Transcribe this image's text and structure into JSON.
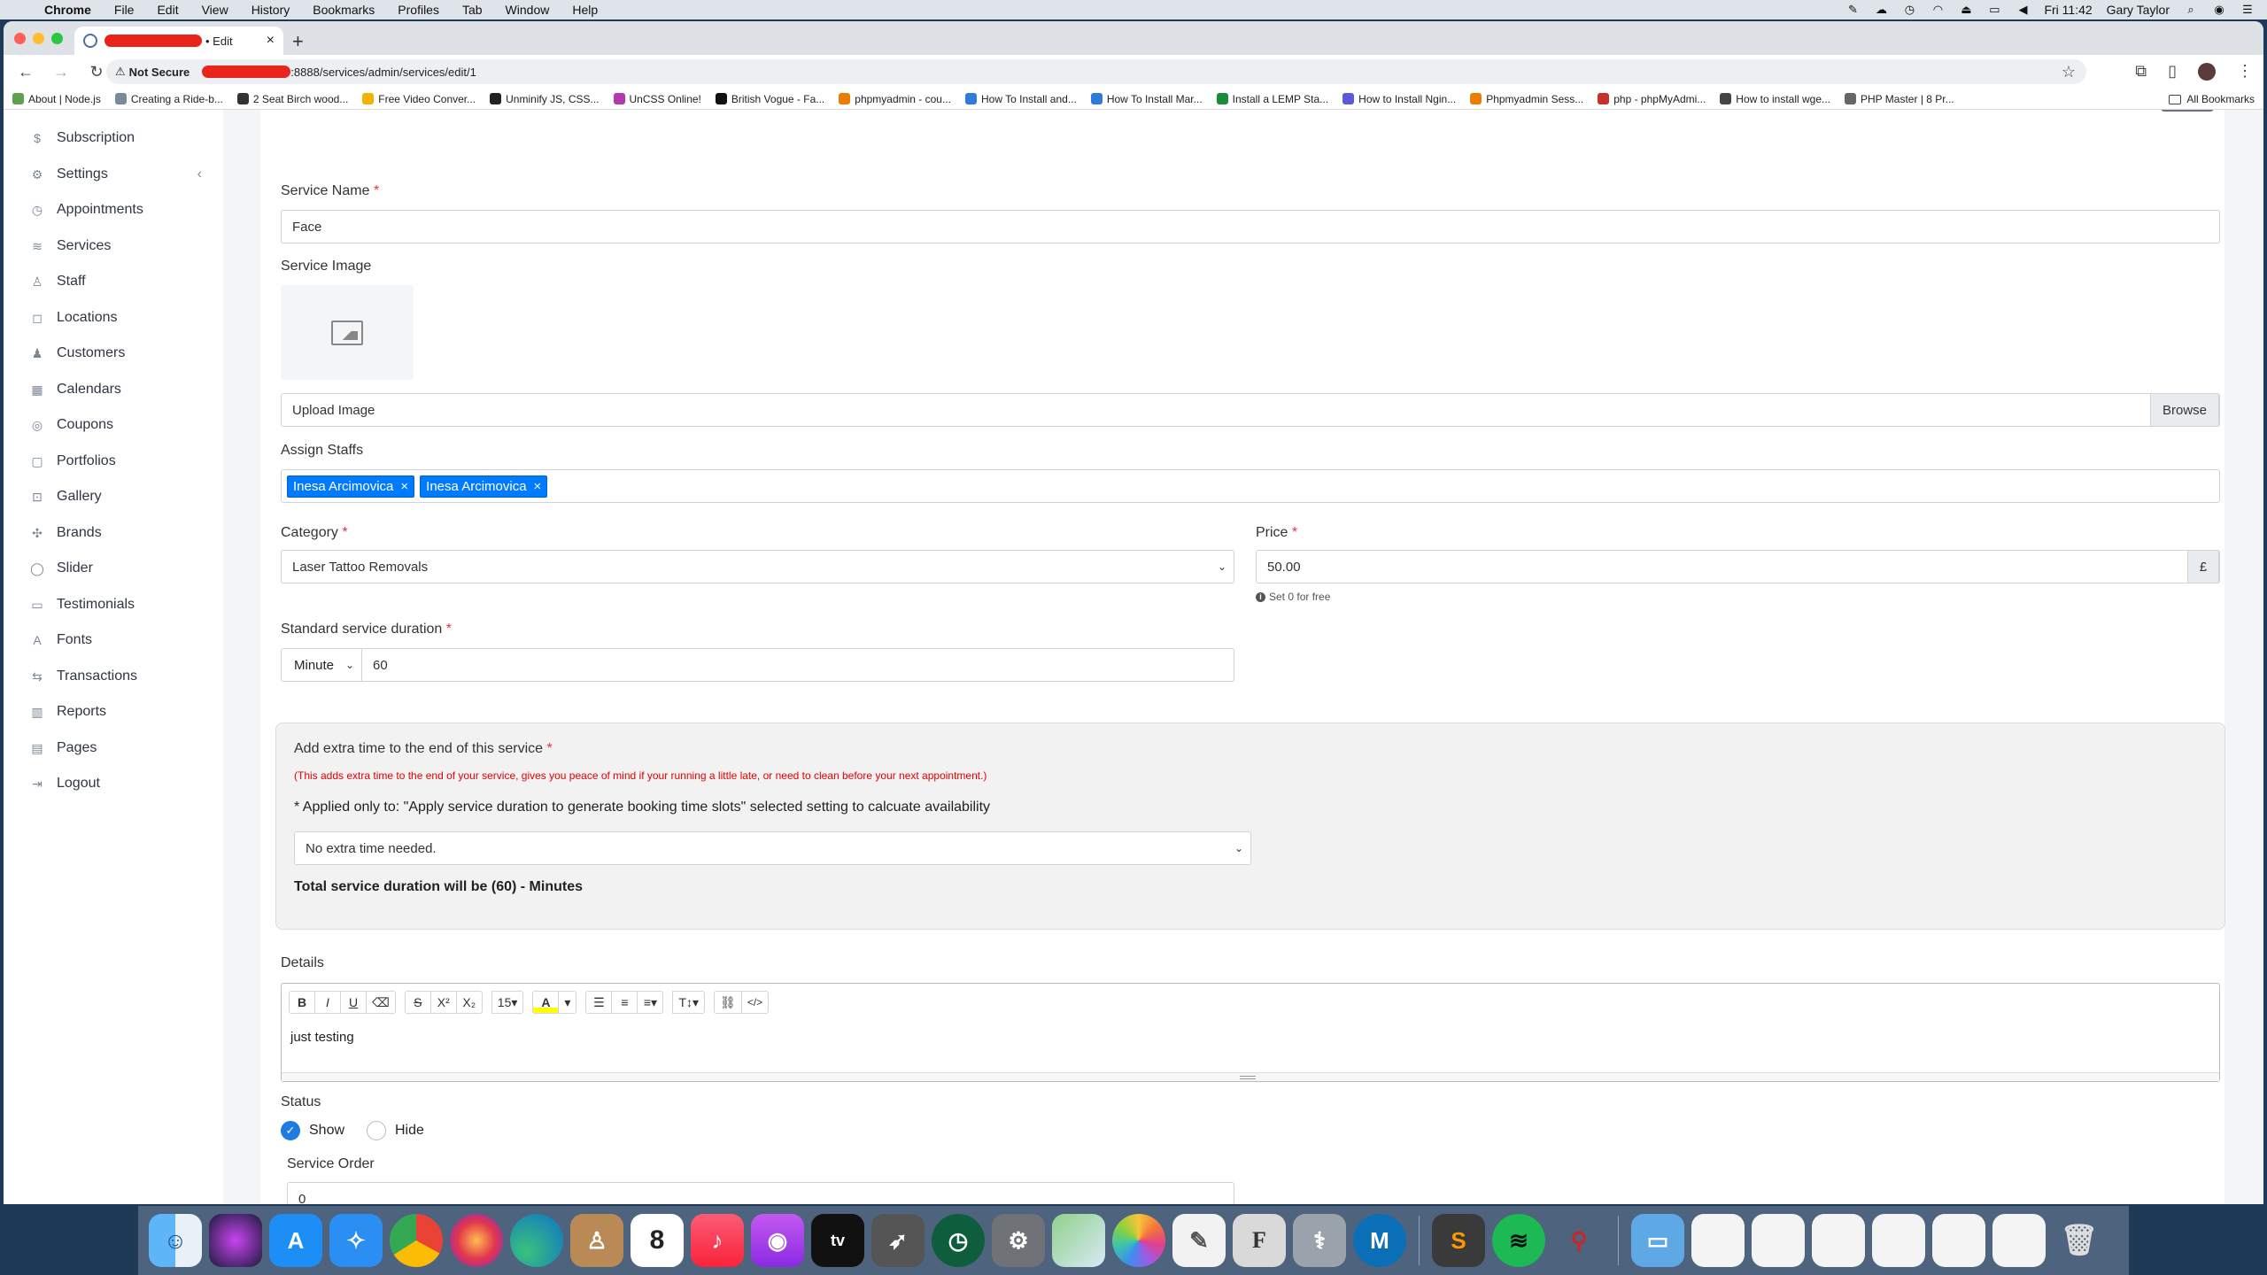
{
  "menubar": {
    "app": "Chrome",
    "items": [
      "File",
      "Edit",
      "View",
      "History",
      "Bookmarks",
      "Profiles",
      "Tab",
      "Window",
      "Help"
    ],
    "clock": "Fri 11:42",
    "user": "Gary Taylor"
  },
  "browser": {
    "tab_title": "• Edit",
    "security": "Not Secure",
    "url": ":8888/services/admin/services/edit/1",
    "bookmarks": [
      "About | Node.js",
      "Creating a Ride-b...",
      "2 Seat Birch wood...",
      "Free Video Conver...",
      "Unminify JS, CSS...",
      "UnCSS Online!",
      "British Vogue - Fa...",
      "phpmyadmin - cou...",
      "How To Install and...",
      "How To Install Mar...",
      "Install a LEMP Sta...",
      "How to Install Ngin...",
      "Phpmyadmin Sess...",
      "php - phpMyAdmi...",
      "How to install wge...",
      "PHP Master | 8 Pr..."
    ],
    "all_bookmarks": "All Bookmarks",
    "more": "»"
  },
  "sidebar": {
    "items": [
      {
        "label": "Subscription",
        "icon": "$"
      },
      {
        "label": "Settings",
        "icon": "⚙"
      },
      {
        "label": "Appointments",
        "icon": "◷"
      },
      {
        "label": "Services",
        "icon": "≋"
      },
      {
        "label": "Staff",
        "icon": "♙"
      },
      {
        "label": "Locations",
        "icon": "◻"
      },
      {
        "label": "Customers",
        "icon": "♟"
      },
      {
        "label": "Calendars",
        "icon": "▦"
      },
      {
        "label": "Coupons",
        "icon": "◎"
      },
      {
        "label": "Portfolios",
        "icon": "▢"
      },
      {
        "label": "Gallery",
        "icon": "⊡"
      },
      {
        "label": "Brands",
        "icon": "✣"
      },
      {
        "label": "Slider",
        "icon": "◯"
      },
      {
        "label": "Testimonials",
        "icon": "▭"
      },
      {
        "label": "Fonts",
        "icon": "A"
      },
      {
        "label": "Transactions",
        "icon": "⇆"
      },
      {
        "label": "Reports",
        "icon": "▥"
      },
      {
        "label": "Pages",
        "icon": "▤"
      },
      {
        "label": "Logout",
        "icon": "⇥"
      }
    ],
    "settings_chevron": "‹"
  },
  "form": {
    "service_name_label": "Service Name",
    "service_name_value": "Face",
    "service_image_label": "Service Image",
    "upload_placeholder": "Upload Image",
    "browse_label": "Browse",
    "assign_staffs_label": "Assign Staffs",
    "staffs": [
      "Inesa Arcimovica",
      "Inesa Arcimovica"
    ],
    "tag_remove": "×",
    "category_label": "Category",
    "category_value": "Laser Tattoo Removals",
    "price_label": "Price",
    "price_value": "50.00",
    "currency": "£",
    "price_help": "Set 0 for free",
    "duration_label": "Standard service duration",
    "duration_unit": "Minute",
    "duration_value": "60",
    "required_mark": "*"
  },
  "extra": {
    "title": "Add extra time to the end of this service",
    "note": "(This adds extra time to the end of your service, gives you peace of mind if your running a little late, or need to clean before your next appointment.)",
    "applied": "* Applied only to: \"Apply service duration to generate booking time slots\" selected setting to calcuate availability",
    "select_value": "No extra time needed.",
    "total": "Total service duration will be (60) - Minutes"
  },
  "details": {
    "label": "Details",
    "content": "just testing",
    "font_size": "15",
    "toolbar": {
      "bold": "B",
      "italic": "I",
      "underline": "U",
      "eraser": "⌫",
      "strike": "S",
      "sup": "X²",
      "sub": "X₂",
      "color": "A",
      "ul": "☰",
      "ol": "≡",
      "align": "≡",
      "height": "T↕",
      "link": "⛓",
      "code": "</>"
    }
  },
  "status": {
    "label": "Status",
    "show": "Show",
    "hide": "Hide",
    "selected": "show"
  },
  "order": {
    "label": "Service Order",
    "value": "0"
  },
  "colors": {
    "primary": "#007bff",
    "required": "#dc3545",
    "note_red": "#e60000"
  }
}
